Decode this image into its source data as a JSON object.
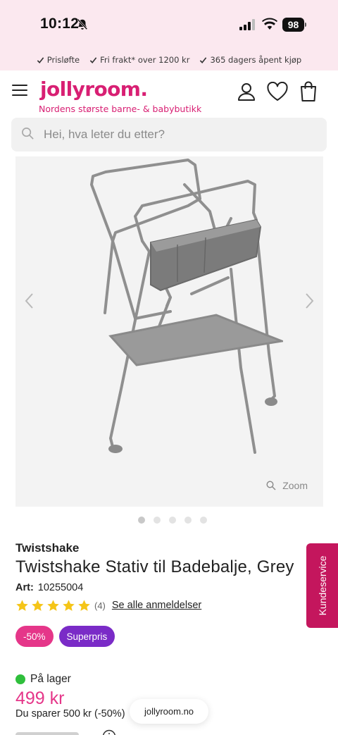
{
  "status_bar": {
    "time": "10:12",
    "battery": "98"
  },
  "usp": [
    {
      "label": "Prisløfte"
    },
    {
      "label": "Fri frakt* over 1200 kr"
    },
    {
      "label": "365 dagers åpent kjøp"
    }
  ],
  "header": {
    "logo": "jollyroom.",
    "tagline": "Nordens største barne- & babybutikk"
  },
  "search": {
    "placeholder": "Hei, hva leter du etter?"
  },
  "gallery": {
    "zoom_label": "Zoom",
    "image_count": 5,
    "active_index": 0
  },
  "product": {
    "brand": "Twistshake",
    "title": "Twistshake Stativ til Badebalje, Grey",
    "art_label": "Art:",
    "art_number": "10255004",
    "rating": 5,
    "review_count": "(4)",
    "reviews_link": "Se alle anmeldelser",
    "badges": {
      "discount": "-50%",
      "special": "Superpris"
    },
    "stock": "På lager",
    "price": "499 kr",
    "savings": "Du sparer 500 kr (-50%)"
  },
  "browser": {
    "url": "jollyroom.no"
  },
  "kundeservice": {
    "label": "Kundeservice"
  },
  "colors": {
    "brand": "#d81f73",
    "discount": "#e53689",
    "special": "#7a2bc7",
    "stock": "#2fbf3c",
    "tab": "#c4165d"
  }
}
